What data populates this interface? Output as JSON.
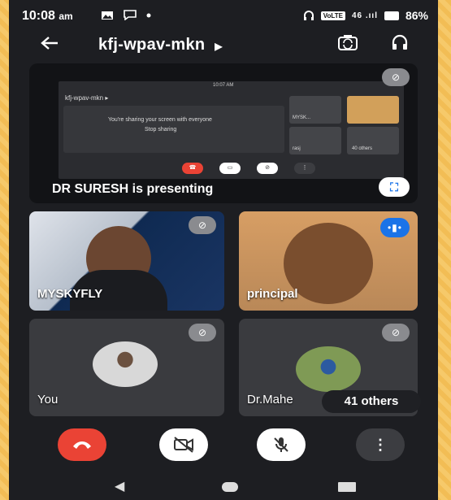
{
  "status_bar": {
    "time": "10:08",
    "ampm": "am",
    "network_badge": "VoLTE",
    "signal_text": "46 .ııl",
    "battery": "86%"
  },
  "header": {
    "meeting_code": "kfj-wpav-mkn",
    "back_icon": "arrow-left-icon",
    "camera_switch_icon": "camera-switch-icon",
    "audio_output_icon": "headphones-icon"
  },
  "presentation": {
    "label": "DR SURESH is presenting",
    "shared_screen": {
      "time": "10:07 AM",
      "title": "kfj-wpav-mkn ▸",
      "sharing_message": "You're sharing your screen with everyone",
      "stop_sharing": "Stop sharing",
      "tiles": [
        "MYSK...",
        "rasj",
        "40 others"
      ]
    }
  },
  "participants": [
    {
      "name": "MYSKYFLY",
      "muted": true
    },
    {
      "name": "principal",
      "speaking": true
    },
    {
      "name": "You",
      "muted": true
    },
    {
      "name": "Dr.Mahe",
      "muted": true
    }
  ],
  "others_chip": "41 others",
  "controls": {
    "end_call": "end-call-icon",
    "camera": "camera-off-icon",
    "microphone": "mic-off-icon",
    "more": "more-vert-icon"
  },
  "colors": {
    "end_call": "#ea4335",
    "accent_blue": "#1a73e8",
    "background": "#1d1e22"
  }
}
